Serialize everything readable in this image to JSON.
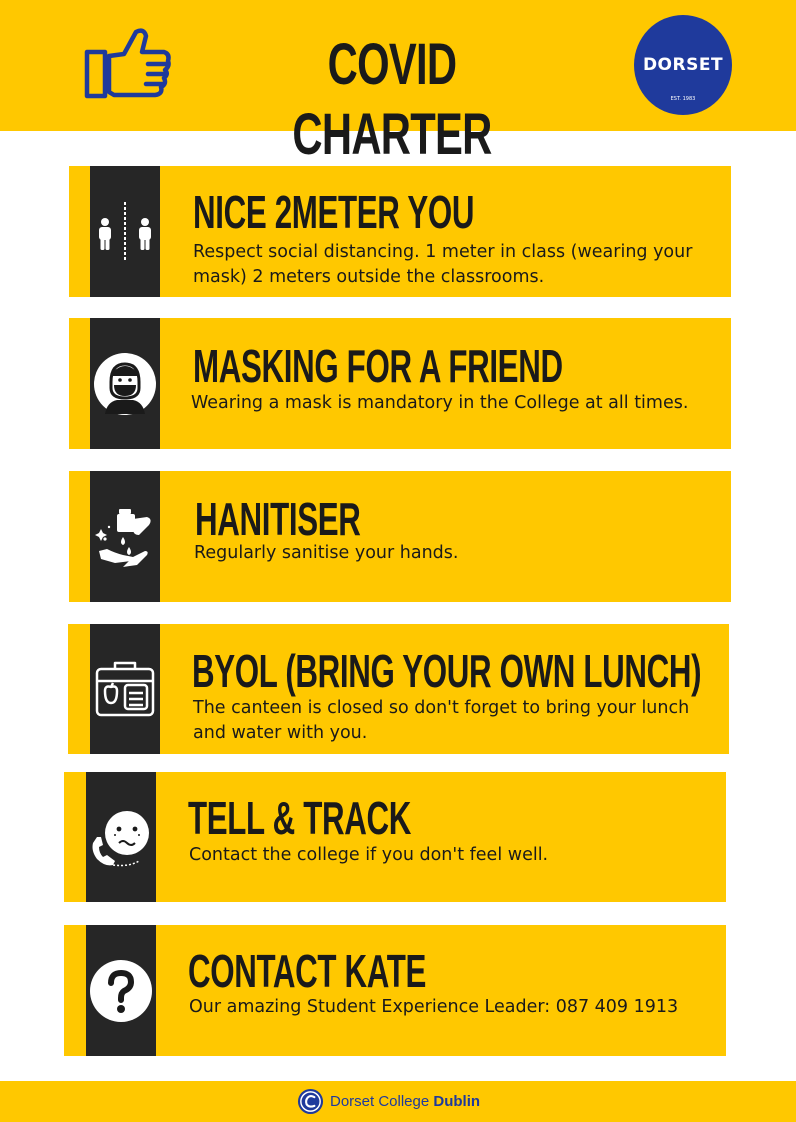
{
  "header": {
    "title": "COVID CHARTER",
    "logo_text": "DORSET",
    "logo_est": "EST. 1983",
    "icon": "thumbs-up-icon"
  },
  "colors": {
    "accent": "#ffc800",
    "strip": "#262626",
    "brand": "#1f3a9c",
    "text": "#1a1a1a"
  },
  "cards": [
    {
      "title": "NICE 2METER YOU",
      "desc_line1": "Respect social distancing. 1 meter in class (wearing your",
      "desc_line2": "mask) 2 meters outside the classrooms.",
      "icon": "social-distancing-icon"
    },
    {
      "title": "MASKING FOR A FRIEND",
      "desc_line1": "Wearing a mask is mandatory in the College at all times.",
      "icon": "face-mask-icon"
    },
    {
      "title": "HANITISER",
      "desc_line1": "Regularly sanitise your hands.",
      "icon": "hand-sanitiser-icon"
    },
    {
      "title": "BYOL (BRING YOUR OWN LUNCH)",
      "desc_line1": "The canteen is closed so don't forget to bring your lunch",
      "desc_line2": "and water with you.",
      "icon": "lunchbox-icon"
    },
    {
      "title": "TELL & TRACK",
      "desc_line1": "Contact the college if you don't feel well.",
      "icon": "sick-phone-call-icon"
    },
    {
      "title": "CONTACT KATE",
      "desc_line1": "Our amazing Student Experience Leader: 087 409 1913",
      "icon": "question-mark-icon"
    }
  ],
  "footer": {
    "name_regular": "Dorset College ",
    "name_bold": "Dublin",
    "icon": "dorset-mark-icon"
  }
}
